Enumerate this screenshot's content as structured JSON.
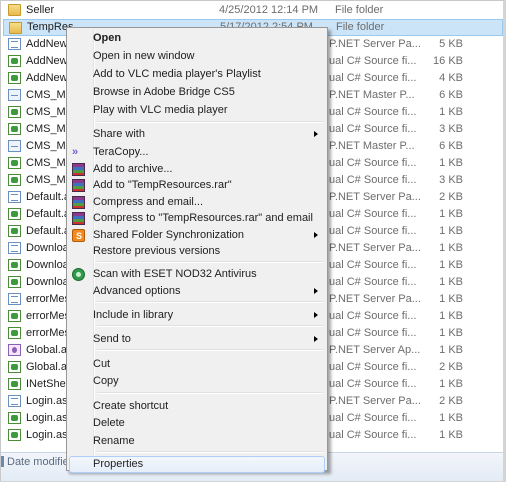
{
  "files": [
    {
      "name": "Seller",
      "date": "4/25/2012 12:14 PM",
      "type": "File folder",
      "size": "",
      "icon": "folder-icon"
    },
    {
      "name": "TempRes",
      "date": "5/17/2012 2:54 PM",
      "type": "File folder",
      "size": "",
      "icon": "folder-icon"
    },
    {
      "name": "AddNewM",
      "date": "",
      "type": "P.NET Server Pa...",
      "size": "5 KB",
      "icon": "aspx-file-icon"
    },
    {
      "name": "AddNewM",
      "date": "",
      "type": "ual C# Source fi...",
      "size": "16 KB",
      "icon": "cs-file-icon"
    },
    {
      "name": "AddNewM",
      "date": "",
      "type": "ual C# Source fi...",
      "size": "4 KB",
      "icon": "cs-file-icon"
    },
    {
      "name": "CMS_Mas",
      "date": "",
      "type": "P.NET Master P...",
      "size": "6 KB",
      "icon": "master-file-icon"
    },
    {
      "name": "CMS_Mas",
      "date": "",
      "type": "ual C# Source fi...",
      "size": "1 KB",
      "icon": "cs-file-icon"
    },
    {
      "name": "CMS_Mas",
      "date": "",
      "type": "ual C# Source fi...",
      "size": "3 KB",
      "icon": "cs-file-icon"
    },
    {
      "name": "CMS_Mas",
      "date": "",
      "type": "P.NET Master P...",
      "size": "6 KB",
      "icon": "master-file-icon"
    },
    {
      "name": "CMS_Mas",
      "date": "",
      "type": "ual C# Source fi...",
      "size": "1 KB",
      "icon": "cs-file-icon"
    },
    {
      "name": "CMS_Mas",
      "date": "",
      "type": "ual C# Source fi...",
      "size": "3 KB",
      "icon": "cs-file-icon"
    },
    {
      "name": "Default.as",
      "date": "",
      "type": "P.NET Server Pa...",
      "size": "2 KB",
      "icon": "aspx-file-icon"
    },
    {
      "name": "Default.as",
      "date": "",
      "type": "ual C# Source fi...",
      "size": "1 KB",
      "icon": "cs-file-icon"
    },
    {
      "name": "Default.as",
      "date": "",
      "type": "ual C# Source fi...",
      "size": "1 KB",
      "icon": "cs-file-icon"
    },
    {
      "name": "Download",
      "date": "",
      "type": "P.NET Server Pa...",
      "size": "1 KB",
      "icon": "aspx-file-icon"
    },
    {
      "name": "Download",
      "date": "",
      "type": "ual C# Source fi...",
      "size": "1 KB",
      "icon": "cs-file-icon"
    },
    {
      "name": "Download",
      "date": "",
      "type": "ual C# Source fi...",
      "size": "1 KB",
      "icon": "cs-file-icon"
    },
    {
      "name": "errorMess",
      "date": "",
      "type": "P.NET Server Pa...",
      "size": "1 KB",
      "icon": "aspx-file-icon"
    },
    {
      "name": "errorMess",
      "date": "",
      "type": "ual C# Source fi...",
      "size": "1 KB",
      "icon": "cs-file-icon"
    },
    {
      "name": "errorMess",
      "date": "",
      "type": "ual C# Source fi...",
      "size": "1 KB",
      "icon": "cs-file-icon"
    },
    {
      "name": "Global.asa",
      "date": "",
      "type": "P.NET Server Ap...",
      "size": "1 KB",
      "icon": "global-file-icon"
    },
    {
      "name": "Global.asa",
      "date": "",
      "type": "ual C# Source fi...",
      "size": "2 KB",
      "icon": "cs-file-icon"
    },
    {
      "name": "INetSheet",
      "date": "",
      "type": "ual C# Source fi...",
      "size": "1 KB",
      "icon": "cs-file-icon"
    },
    {
      "name": "Login.aspx",
      "date": "",
      "type": "P.NET Server Pa...",
      "size": "2 KB",
      "icon": "aspx-file-icon"
    },
    {
      "name": "Login.asp",
      "date": "",
      "type": "ual C# Source fi...",
      "size": "1 KB",
      "icon": "cs-file-icon"
    },
    {
      "name": "Login.asp",
      "date": "",
      "type": "ual C# Source fi...",
      "size": "1 KB",
      "icon": "cs-file-icon"
    }
  ],
  "status_bar": {
    "label": "Date modified"
  },
  "context_menu": {
    "items": [
      {
        "label": "Open",
        "bold": true
      },
      {
        "label": "Open in new window"
      },
      {
        "label": "Add to VLC media player's Playlist"
      },
      {
        "label": "Browse in Adobe Bridge CS5"
      },
      {
        "label": "Play with VLC media player"
      },
      {
        "label": "Share with",
        "submenu": true
      },
      {
        "label": "TeraCopy...",
        "icon": "teracopy-icon"
      },
      {
        "label": "Add to archive...",
        "icon": "winrar-icon"
      },
      {
        "label": "Add to \"TempResources.rar\"",
        "icon": "winrar-icon"
      },
      {
        "label": "Compress and email...",
        "icon": "winrar-icon"
      },
      {
        "label": "Compress to \"TempResources.rar\" and email",
        "icon": "winrar-icon"
      },
      {
        "label": "Shared Folder Synchronization",
        "icon": "sync-icon",
        "submenu": true
      },
      {
        "label": "Restore previous versions"
      },
      {
        "label": "Scan with ESET NOD32 Antivirus",
        "icon": "eset-icon"
      },
      {
        "label": "Advanced options",
        "submenu": true
      },
      {
        "label": "Include in library",
        "submenu": true
      },
      {
        "label": "Send to",
        "submenu": true
      },
      {
        "label": "Cut"
      },
      {
        "label": "Copy"
      },
      {
        "label": "Create shortcut"
      },
      {
        "label": "Delete"
      },
      {
        "label": "Rename"
      },
      {
        "label": "Properties",
        "highlighted": true
      }
    ]
  },
  "colors": {
    "selection": "#cce4f7",
    "menu_bg": "#f0f0f0",
    "highlight_border": "#aecff7"
  }
}
